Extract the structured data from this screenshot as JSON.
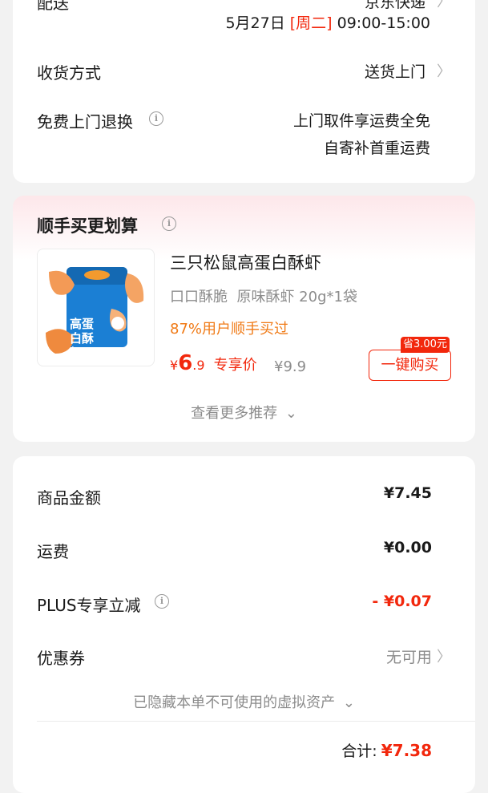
{
  "delivery": {
    "label": "配送",
    "value": "京东快递",
    "date": "5月27日",
    "weekday": "[周二]",
    "time": "09:00-15:00"
  },
  "receive": {
    "label": "收货方式",
    "value": "送货上门"
  },
  "free_return": {
    "label": "免费上门退换",
    "line1": "上门取件享运费全免",
    "line2": "自寄补首重运费"
  },
  "recommend": {
    "title": "顺手买更划算",
    "product_name": "三只松鼠高蛋白酥虾",
    "product_spec": "口口酥脆  原味酥虾 20g*1袋",
    "product_tag": "87%用户顺手买过",
    "price_symbol": "¥",
    "price_int": "6",
    "price_dec": ".9",
    "price_label": "专享价",
    "original_price": "¥9.9",
    "save_badge": "省3.00元",
    "buy_button": "一键购买",
    "more": "查看更多推荐",
    "image_text": "高蛋白酥虾"
  },
  "summary": {
    "goods_label": "商品金额",
    "goods_value": "¥7.45",
    "shipping_label": "运费",
    "shipping_value": "¥0.00",
    "plus_label": "PLUS专享立减",
    "plus_value": "- ¥0.07",
    "coupon_label": "优惠券",
    "coupon_value": "无可用",
    "hidden_assets": "已隐藏本单不可使用的虚拟资产",
    "total_label": "合计:",
    "total_value": "¥7.38"
  },
  "icons": {
    "chevron_right": "〉",
    "chevron_down": "⌄",
    "info": "i"
  },
  "colors": {
    "accent_red": "#f2270c",
    "orange": "#f07a16",
    "background": "#f2f2f2"
  }
}
